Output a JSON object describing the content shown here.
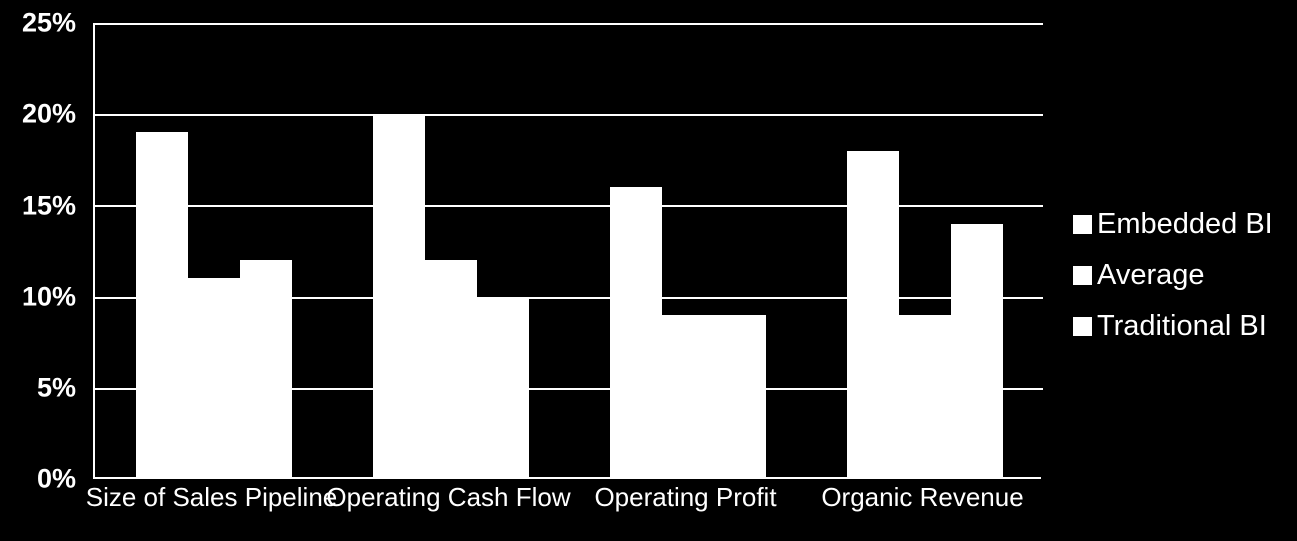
{
  "chart_data": {
    "type": "bar",
    "title": "",
    "subtitle": "",
    "xlabel": "",
    "ylabel": "",
    "categories": [
      "Size of Sales Pipeline",
      "Operating Cash Flow",
      "Operating Profit",
      "Organic Revenue"
    ],
    "series": [
      {
        "name": "Embedded BI",
        "values": [
          19,
          20,
          16,
          18
        ]
      },
      {
        "name": "Average",
        "values": [
          11,
          12,
          9,
          9
        ]
      },
      {
        "name": "Traditional BI",
        "values": [
          12,
          10,
          9,
          14
        ]
      }
    ],
    "ylim": [
      0,
      25
    ],
    "ytick_values": [
      0,
      5,
      10,
      15,
      20,
      25
    ],
    "ytick_labels": [
      "0%",
      "5%",
      "10%",
      "15%",
      "20%",
      "25%"
    ],
    "grid": true,
    "grid_axis": "y",
    "legend_position": "right",
    "value_format": "percent",
    "colors": {
      "background": "#000000",
      "foreground": "#ffffff",
      "bar_fill": "#ffffff",
      "gridline": "#ffffff",
      "axis": "#ffffff"
    }
  }
}
